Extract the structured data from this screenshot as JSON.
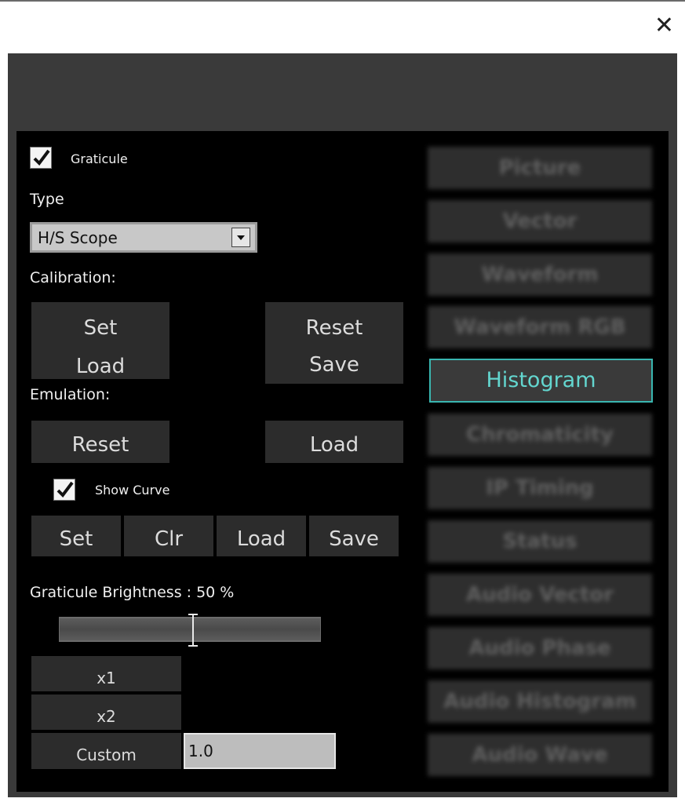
{
  "window": {
    "close_icon": "close-icon"
  },
  "graticule": {
    "checkbox_label": "Graticule",
    "checked": true
  },
  "type": {
    "label": "Type",
    "selected": "H/S Scope"
  },
  "calibration": {
    "label": "Calibration:",
    "set_load_lines": [
      "Set",
      "Load"
    ],
    "reset_save_lines": [
      "Reset",
      "Save"
    ]
  },
  "emulation": {
    "label": "Emulation:",
    "reset": "Reset",
    "load": "Load"
  },
  "curve": {
    "show_curve_label": "Show Curve",
    "checked": true,
    "buttons": [
      "Set",
      "Clr",
      "Load",
      "Save"
    ]
  },
  "brightness": {
    "label": "Graticule Brightness : 50 %",
    "value_percent": 50
  },
  "scale": {
    "x1": "x1",
    "x2": "x2",
    "custom": "Custom",
    "custom_value": "1.0"
  },
  "modes": {
    "items": [
      "Picture",
      "Vector",
      "Waveform",
      "Waveform RGB",
      "Histogram",
      "Chromaticity",
      "IP Timing",
      "Status",
      "Audio Vector",
      "Audio Phase",
      "Audio Histogram",
      "Audio Wave"
    ],
    "active": "Histogram"
  },
  "colors": {
    "accent": "#39b6b0",
    "accent_text": "#63d6cf"
  }
}
